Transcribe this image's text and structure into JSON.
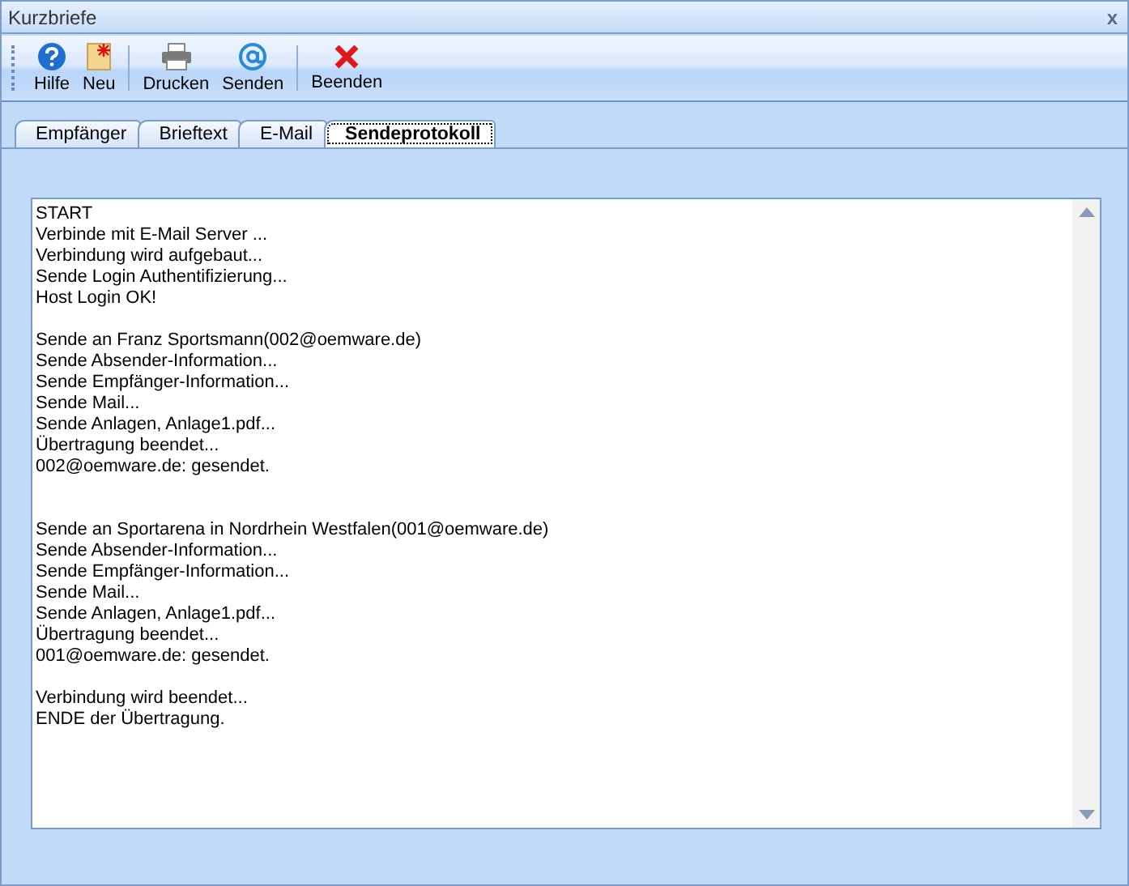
{
  "window": {
    "title": "Kurzbriefe",
    "close": "x"
  },
  "toolbar": [
    {
      "label": "Hilfe",
      "kind": "help"
    },
    {
      "label": "Neu",
      "kind": "new"
    },
    {
      "label": "Drucken",
      "kind": "print",
      "separator_before": true
    },
    {
      "label": "Senden",
      "kind": "send"
    },
    {
      "label": "Beenden",
      "kind": "exit",
      "separator_before": true
    }
  ],
  "tabs": [
    {
      "label": "Empfänger",
      "selected": false
    },
    {
      "label": "Brieftext",
      "selected": false
    },
    {
      "label": "E-Mail",
      "selected": false
    },
    {
      "label": "Sendeprotokoll",
      "selected": true
    }
  ],
  "log": "START\nVerbinde mit E-Mail Server ...\nVerbindung wird aufgebaut...\nSende Login Authentifizierung...\nHost Login OK!\n\nSende an Franz Sportsmann(002@oemware.de)\nSende Absender-Information...\nSende Empfänger-Information...\nSende Mail...\nSende Anlagen, Anlage1.pdf...\nÜbertragung beendet...\n002@oemware.de: gesendet.\n\n\nSende an Sportarena in Nordrhein Westfalen(001@oemware.de)\nSende Absender-Information...\nSende Empfänger-Information...\nSende Mail...\nSende Anlagen, Anlage1.pdf...\nÜbertragung beendet...\n001@oemware.de: gesendet.\n\nVerbindung wird beendet...\nENDE der Übertragung."
}
